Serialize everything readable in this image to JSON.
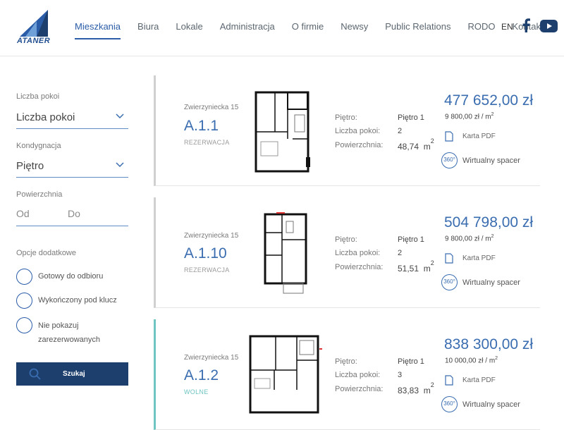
{
  "header": {
    "logo_text": "ATANER",
    "nav": [
      "Mieszkania",
      "Biura",
      "Lokale",
      "Administracja",
      "O firmie",
      "Newsy",
      "Public Relations",
      "RODO",
      "Kontakt"
    ],
    "lang": "EN",
    "social_icons": [
      "facebook-icon",
      "youtube-icon"
    ],
    "accent_color": "#2a5ca8"
  },
  "sidebar": {
    "rooms_label": "Liczba pokoi",
    "rooms_value": "Liczba pokoi",
    "floor_label": "Kondygnacja",
    "floor_value": "Piętro",
    "area_label": "Powierzchnia",
    "area_from": "Od",
    "area_to": "Do",
    "options_label": "Opcje dodatkowe",
    "options": [
      "Gotowy do odbioru",
      "Wykończony pod klucz",
      "Nie pokazuj zarezerwowanych"
    ],
    "search_label": "Szukaj"
  },
  "listing_labels": {
    "floor": "Piętro:",
    "rooms": "Liczba pokoi:",
    "area": "Powierzchnia:",
    "pdf": "Karta PDF",
    "tour": "Wirtualny spacer",
    "tour_badge": "360°"
  },
  "listings": [
    {
      "street": "Zwierzyniecka 15",
      "id": "A.1.1",
      "status": "REZERWACJA",
      "floor": "Piętro 1",
      "rooms": "2",
      "area": "48,74",
      "area_unit": "m",
      "price": "477 652,00 zł",
      "price_per_m2": "9 800,00 zł / m"
    },
    {
      "street": "Zwierzyniecka 15",
      "id": "A.1.10",
      "status": "REZERWACJA",
      "floor": "Piętro 1",
      "rooms": "2",
      "area": "51,51",
      "area_unit": "m",
      "price": "504 798,00 zł",
      "price_per_m2": "9 800,00 zł / m"
    },
    {
      "street": "Zwierzyniecka 15",
      "id": "A.1.2",
      "status": "WOLNE",
      "floor": "Piętro 1",
      "rooms": "3",
      "area": "83,83",
      "area_unit": "m",
      "price": "838 300,00 zł",
      "price_per_m2": "10 000,00 zł / m"
    }
  ],
  "colors": {
    "reserved_border": "#d0d0d0",
    "free_border": "#6ec5c2",
    "price": "#3a6db0",
    "button": "#1d3f6e"
  }
}
